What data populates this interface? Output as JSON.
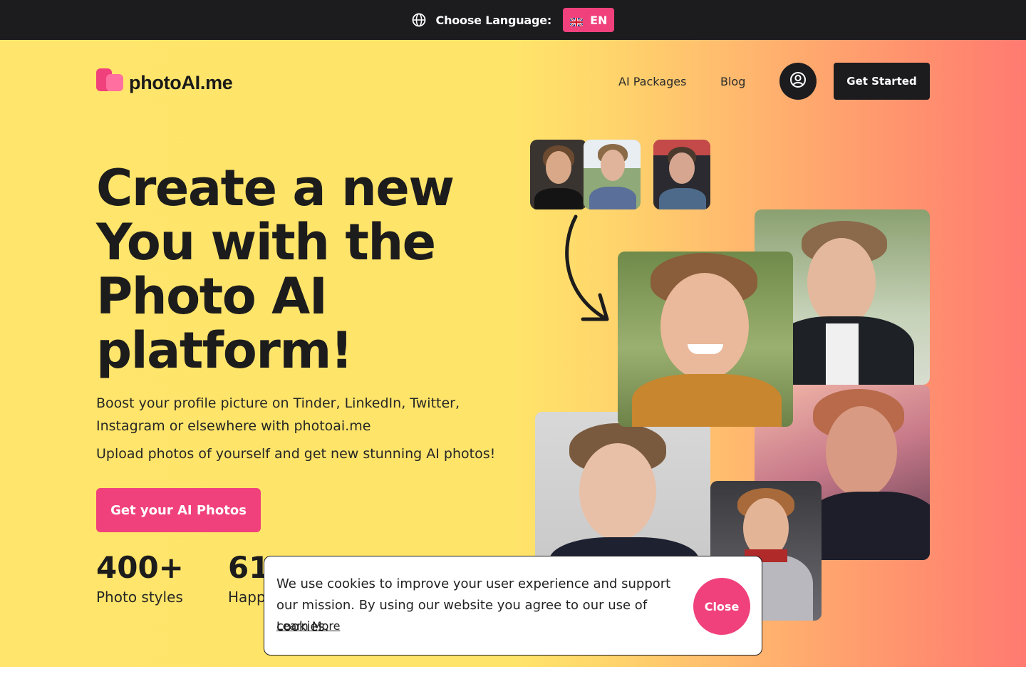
{
  "langbar": {
    "label": "Choose Language:",
    "current_language": "EN",
    "globe_icon": "globe-icon",
    "flag_icon": "uk-flag-icon",
    "accent": "#f0417c"
  },
  "nav": {
    "logo_text": "photoAI.me",
    "links": [
      "AI Packages",
      "Blog"
    ],
    "account_icon": "user-circle-icon",
    "cta": "Get Started"
  },
  "hero": {
    "headline": "Create a new You with the Photo AI platform!",
    "subtitle": "Boost your profile picture on Tinder, LinkedIn, Twitter, Instagram or elsewhere with photoai.me",
    "subtitle2": "Upload photos of yourself and get new stunning AI photos!",
    "cta": "Get your AI Photos",
    "arrow_icon": "curved-arrow-icon"
  },
  "stats": [
    {
      "number": "400+",
      "label": "Photo styles"
    },
    {
      "number": "61",
      "label": "Happ"
    }
  ],
  "cookie": {
    "text": "We use cookies to improve your user experience and support our mission. By using our website you agree to our use of cookies.",
    "link": "Learn More",
    "close": "Close"
  },
  "colors": {
    "dark": "#1c1c1f",
    "pink": "#f0417c",
    "yellow": "#ffe56b",
    "coral": "#ff7a70"
  }
}
